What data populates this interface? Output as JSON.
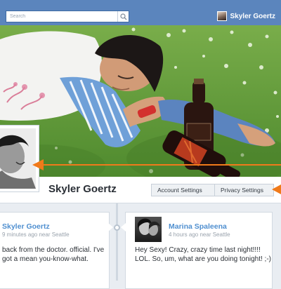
{
  "topbar": {
    "search_placeholder": "Search",
    "search_icon": "search-icon",
    "user_name": "Skyler Goertz"
  },
  "profile": {
    "name": "Skyler Goertz",
    "account_settings_label": "Account Settings",
    "privacy_settings_label": "Privacy Settings"
  },
  "posts": [
    {
      "author": "Skyler Goertz",
      "meta": "9 minutes ago near Seattle",
      "text": "back from the doctor. official. I've got a mean you-know-what."
    },
    {
      "author": "Marina Spaleena",
      "meta": "4 hours ago near Seattle",
      "text": "Hey Sexy! Crazy, crazy time last night!!!! LOL. So, um, what are you doing tonight! ;-)"
    }
  ],
  "colors": {
    "topbar": "#5b85bd",
    "link_blue": "#4f8fd0",
    "annotation_orange": "#f07a1a",
    "grass_green": "#5f9438"
  }
}
